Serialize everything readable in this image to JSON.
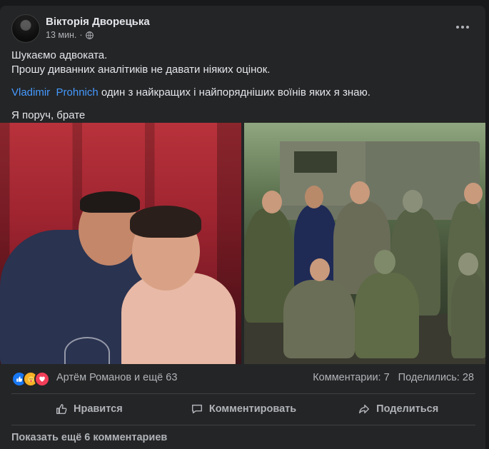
{
  "post": {
    "author": "Вікторія Дворецька",
    "time": "13 мин.",
    "separator": "·",
    "text": {
      "line1": "Шукаємо адвоката.",
      "line2": "Прошу диванних аналітиків не давати ніяких оцінок.",
      "mention_first": "Vladimir",
      "mention_last": "Prohnich",
      "line3_rest": " один з найкращих і найпорядніших воїнів яких я знаю.",
      "line4": "Я поруч, брате"
    }
  },
  "reactions": {
    "icons": [
      "like-icon",
      "care-icon",
      "love-icon"
    ],
    "names": "Артём Романов и ещё 63",
    "comments": "Комментарии: 7",
    "shares": "Поделились: 28"
  },
  "actions": {
    "like": "Нравится",
    "comment": "Комментировать",
    "share": "Поделиться"
  },
  "show_more_comments": "Показать ещё 6 комментариев",
  "colors": {
    "background": "#18191a",
    "card": "#242526",
    "text_primary": "#e4e6eb",
    "text_secondary": "#b0b3b8",
    "mention": "#4599ff"
  }
}
